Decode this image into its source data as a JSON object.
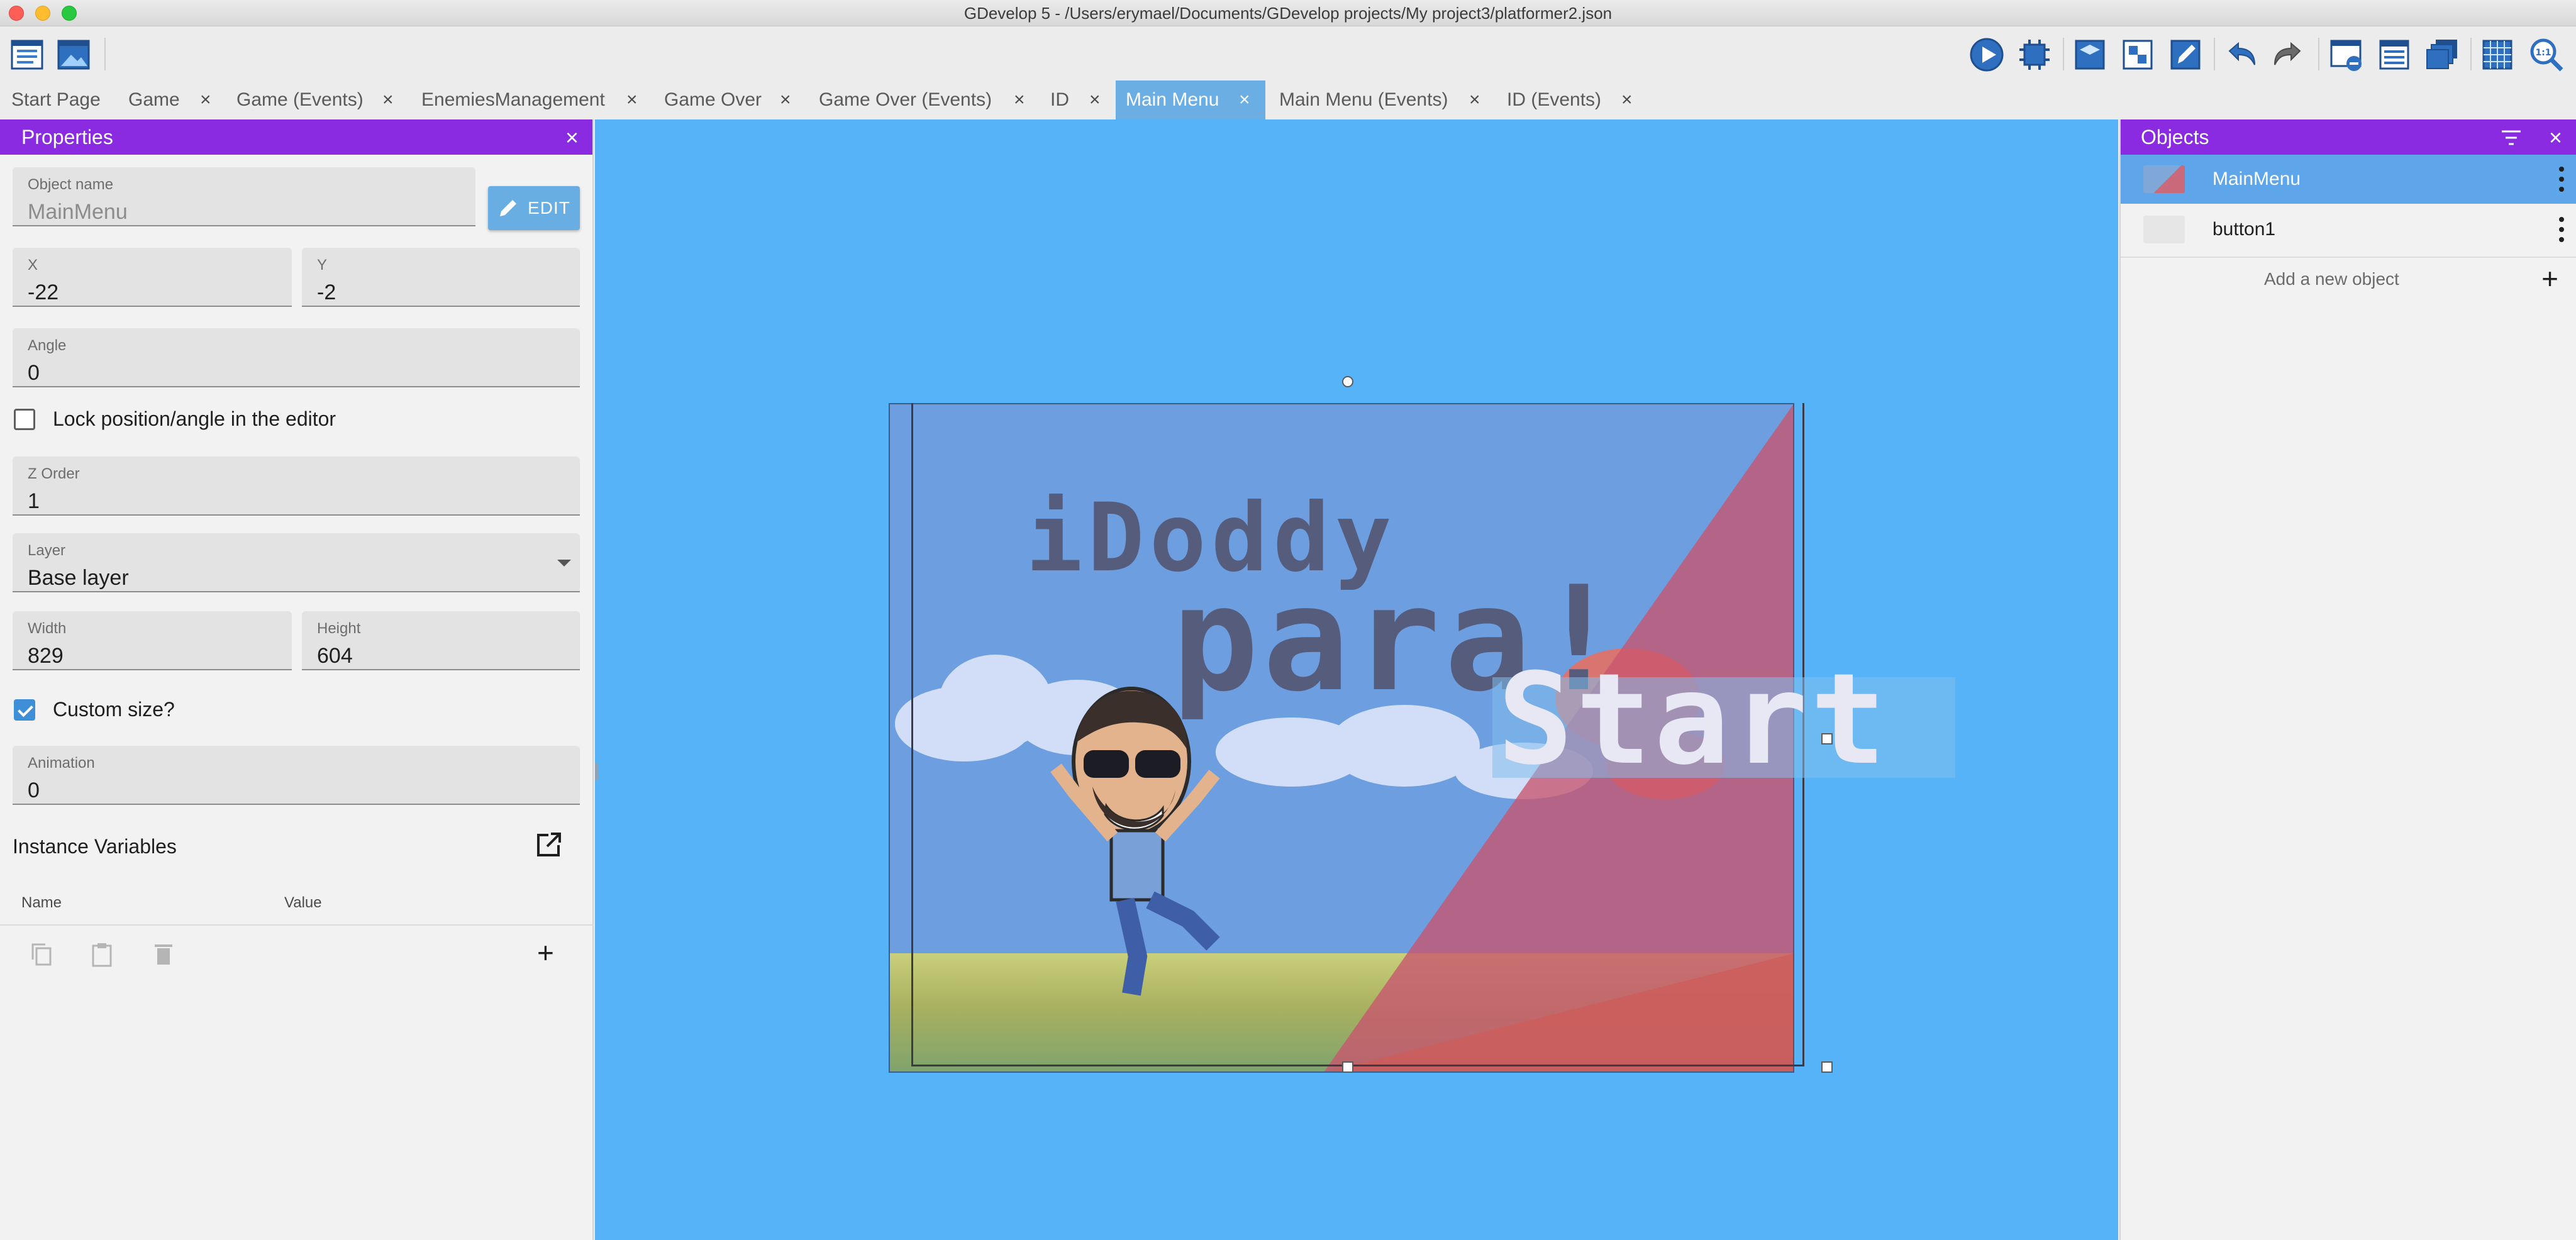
{
  "window": {
    "title": "GDevelop 5 - /Users/erymael/Documents/GDevelop projects/My project3/platformer2.json"
  },
  "toolbar": {
    "left_icons": [
      "project-manager-icon",
      "scene-icon"
    ],
    "right_icons": [
      "preview-play-icon",
      "debug-icon",
      "scene-properties-icon",
      "layers-icon",
      "instances-editor-icon",
      "undo-icon",
      "redo-icon",
      "hide-properties-icon",
      "instances-list-icon",
      "layers-window-icon",
      "grid-icon",
      "zoom-reset-icon"
    ]
  },
  "tabs": [
    {
      "label": "Start Page",
      "closable": false
    },
    {
      "label": "Game",
      "closable": true
    },
    {
      "label": "Game (Events)",
      "closable": true
    },
    {
      "label": "EnemiesManagement",
      "closable": true
    },
    {
      "label": "Game Over",
      "closable": true
    },
    {
      "label": "Game Over (Events)",
      "closable": true
    },
    {
      "label": "ID",
      "closable": true
    },
    {
      "label": "Main Menu",
      "closable": true,
      "active": true
    },
    {
      "label": "Main Menu (Events)",
      "closable": true
    },
    {
      "label": "ID (Events)",
      "closable": true
    }
  ],
  "tab_close_glyph": "×",
  "properties": {
    "title": "Properties",
    "close_glyph": "×",
    "object_name": {
      "label": "Object name",
      "value": "MainMenu"
    },
    "edit_button": "EDIT",
    "x": {
      "label": "X",
      "value": "-22"
    },
    "y": {
      "label": "Y",
      "value": "-2"
    },
    "angle": {
      "label": "Angle",
      "value": "0"
    },
    "lock": {
      "label": "Lock position/angle in the editor",
      "checked": false
    },
    "z_order": {
      "label": "Z Order",
      "value": "1"
    },
    "layer": {
      "label": "Layer",
      "value": "Base layer"
    },
    "width": {
      "label": "Width",
      "value": "829"
    },
    "height": {
      "label": "Height",
      "value": "604"
    },
    "custom_size": {
      "label": "Custom size?",
      "checked": true
    },
    "animation": {
      "label": "Animation",
      "value": "0"
    },
    "instance_variables": {
      "title": "Instance Variables",
      "col_name": "Name",
      "col_value": "Value",
      "add_glyph": "+"
    }
  },
  "canvas": {
    "background": "#56b3f7",
    "scene_texts": {
      "title_line1": "iDoddy",
      "title_line2": "para!",
      "start": "Start"
    }
  },
  "objects": {
    "title": "Objects",
    "close_glyph": "×",
    "items": [
      {
        "name": "MainMenu",
        "selected": true
      },
      {
        "name": "button1",
        "selected": false
      }
    ],
    "add_label": "Add a new object",
    "add_glyph": "+"
  },
  "colors": {
    "panel_header": "#8a2be2",
    "accent": "#6aaee3",
    "selected_row": "#5fa5ea"
  }
}
